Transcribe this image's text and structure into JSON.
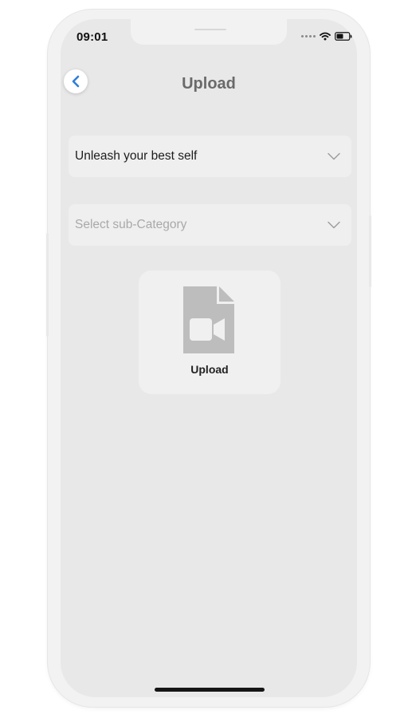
{
  "status_bar": {
    "time": "09:01",
    "icons": [
      "signal-dots-icon",
      "wifi-icon",
      "battery-icon"
    ]
  },
  "header": {
    "back_icon": "chevron-left-icon",
    "title": "Upload"
  },
  "form": {
    "category": {
      "value": "Unleash your best self",
      "icon": "chevron-down-icon"
    },
    "sub_category": {
      "placeholder": "Select sub-Category",
      "icon": "chevron-down-icon"
    }
  },
  "upload_card": {
    "icon": "video-file-icon",
    "label": "Upload"
  },
  "colors": {
    "accent": "#2f7fd6",
    "screen_background": "#e8e8e8",
    "field_background": "#efefef",
    "title": "#6a6a6a",
    "placeholder": "#a9a9a9"
  }
}
